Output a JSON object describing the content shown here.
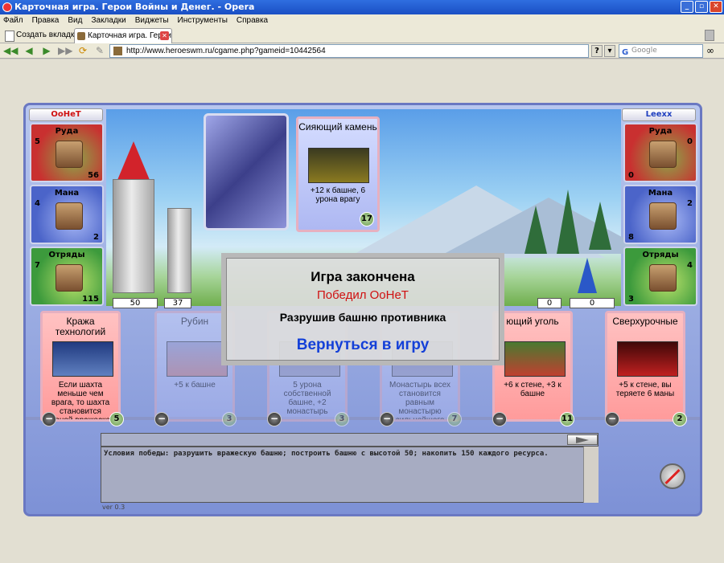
{
  "window": {
    "title": "Карточная игра. Герои Войны и Денег. - Opera"
  },
  "menu": [
    "Файл",
    "Правка",
    "Вид",
    "Закладки",
    "Виджеты",
    "Инструменты",
    "Справка"
  ],
  "tabs": {
    "new_tab": "Создать вкладку",
    "active_tab": "Карточная игра. Герои..."
  },
  "address": {
    "url": "http://www.heroeswm.ru/cgame.php?gameid=10442564",
    "search_placeholder": "Google"
  },
  "player_left": {
    "name": "ОоНеТ",
    "resources": [
      {
        "label": "Руда",
        "count": "5",
        "income": "56"
      },
      {
        "label": "Мана",
        "count": "4",
        "income": "2"
      },
      {
        "label": "Отряды",
        "count": "7",
        "income": "115"
      }
    ],
    "tower": "50",
    "wall": "37"
  },
  "player_right": {
    "name": "Leexx",
    "resources": [
      {
        "label": "Руда",
        "count": "0",
        "income": "0"
      },
      {
        "label": "Мана",
        "count": "2",
        "income": "8"
      },
      {
        "label": "Отряды",
        "count": "4",
        "income": "3"
      }
    ],
    "tower": "0",
    "wall": "0"
  },
  "played_card": {
    "title": "Сияющий камень",
    "desc": "+12 к башне, 6 урона врагу",
    "cost": "17"
  },
  "hand": [
    {
      "title": "Кража технологий",
      "desc": "Если шахта меньше чем врага, то шахта становится равной вражеской",
      "cost": "5",
      "color": "red",
      "faded": false
    },
    {
      "title": "Рубин",
      "desc": "+5 к башне",
      "cost": "3",
      "color": "blue",
      "faded": true
    },
    {
      "title": "",
      "desc": "5 урона собственной башне, +2 монастырь",
      "cost": "3",
      "color": "blue",
      "faded": true
    },
    {
      "title": "",
      "desc": "Монастырь всех становится равным монастырю сильнейшего",
      "cost": "7",
      "color": "blue",
      "faded": true
    },
    {
      "title": "ющий уголь",
      "desc": "+6 к стене, +3 к башне",
      "cost": "11",
      "color": "red",
      "faded": false
    },
    {
      "title": "Сверхурочные",
      "desc": "+5 к стене, вы теряете 6 маны",
      "cost": "2",
      "color": "red",
      "faded": false
    }
  ],
  "dialog": {
    "title": "Игра закончена",
    "winner": "Победил ОоНеТ",
    "reason": "Разрушив башню противника",
    "return": "Вернуться в игру"
  },
  "log": {
    "text": "Условия победы: разрушить вражескую башню; построить башню с высотой 50; накопить 150 каждого ресурса."
  },
  "version": "ver 0.3"
}
